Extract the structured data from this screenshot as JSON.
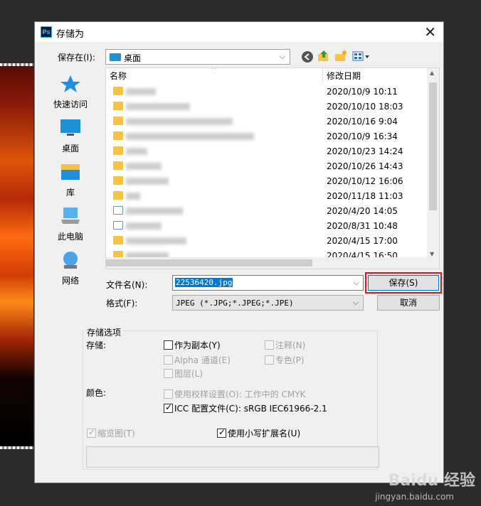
{
  "dialog": {
    "title": "存储为",
    "app_icon": "Ps"
  },
  "save_in": {
    "label": "保存在(I):",
    "value": "桌面"
  },
  "places": [
    {
      "label": "快速访问",
      "icon": "star-icon"
    },
    {
      "label": "桌面",
      "icon": "desktop-icon"
    },
    {
      "label": "库",
      "icon": "library-icon"
    },
    {
      "label": "此电脑",
      "icon": "computer-icon"
    },
    {
      "label": "网络",
      "icon": "network-icon"
    }
  ],
  "columns": {
    "name": "名称",
    "modified": "修改日期"
  },
  "files": [
    {
      "date": "2020/10/9 10:11",
      "type": "folder"
    },
    {
      "date": "2020/10/10 18:03",
      "type": "folder"
    },
    {
      "date": "2020/10/16 9:04",
      "type": "folder"
    },
    {
      "date": "2020/10/9 16:34",
      "type": "folder"
    },
    {
      "date": "2020/10/23 14:24",
      "type": "folder"
    },
    {
      "date": "2020/10/26 14:43",
      "type": "folder"
    },
    {
      "date": "2020/10/12 16:06",
      "type": "folder"
    },
    {
      "date": "2020/11/18 11:03",
      "type": "folder"
    },
    {
      "date": "2020/4/20 14:05",
      "type": "doc"
    },
    {
      "date": "2020/8/31 10:48",
      "type": "doc"
    },
    {
      "date": "2020/4/15 17:00",
      "type": "folder"
    },
    {
      "date": "2020/4/15 16:50",
      "type": "folder"
    }
  ],
  "filename": {
    "label": "文件名(N):",
    "value": "22536420.jpg"
  },
  "format": {
    "label": "格式(F):",
    "value": "JPEG (*.JPG;*.JPEG;*.JPE)"
  },
  "buttons": {
    "save": "保存(S)",
    "cancel": "取消"
  },
  "options": {
    "group_title": "存储选项",
    "save_label": "存储:",
    "as_copy": "作为副本(Y)",
    "annotations": "注释(N)",
    "alpha": "Alpha 通道(E)",
    "spot": "专色(P)",
    "layers": "图层(L)",
    "color_label": "颜色:",
    "proof": "使用校样设置(O):  工作中的 CMYK",
    "icc": "ICC 配置文件(C):  sRGB IEC61966-2.1",
    "thumbnail": "缩览图(T)",
    "lowercase": "使用小写扩展名(U)"
  },
  "watermark": {
    "text": "Baidu 经验",
    "url": "jingyan.baidu.com"
  }
}
